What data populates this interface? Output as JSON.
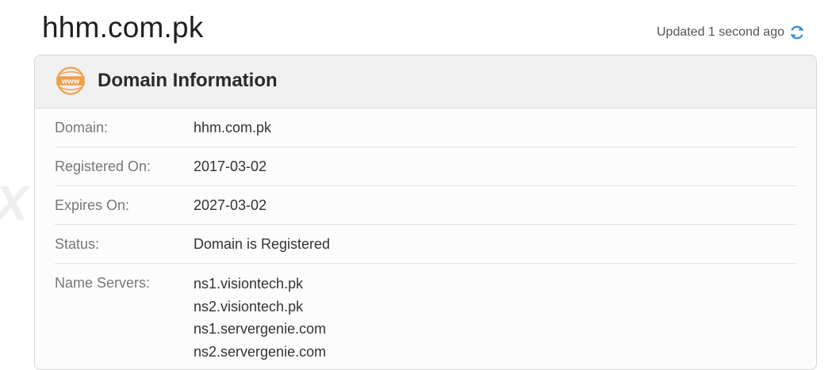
{
  "header": {
    "site_title": "hhm.com.pk",
    "updated_text": "Updated 1 second ago",
    "refresh_icon": "refresh-icon"
  },
  "card": {
    "icon": "www-icon",
    "icon_label": "www",
    "title": "Domain Information",
    "rows": [
      {
        "label": "Domain:",
        "value": "hhm.com.pk"
      },
      {
        "label": "Registered On:",
        "value": "2017-03-02"
      },
      {
        "label": "Expires On:",
        "value": "2027-03-02"
      },
      {
        "label": "Status:",
        "value": "Domain is Registered"
      }
    ],
    "name_servers": {
      "label": "Name Servers:",
      "values": [
        "ns1.visiontech.pk",
        "ns2.visiontech.pk",
        "ns1.servergenie.com",
        "ns2.servergenie.com"
      ]
    }
  },
  "watermark": {
    "text": "WikiFX",
    "left_fragment": "X"
  },
  "colors": {
    "accent_orange": "#f0a04b",
    "refresh_blue": "#3d8fd6",
    "header_bg": "#f1f1f1",
    "card_bg": "#fcfcfc"
  }
}
